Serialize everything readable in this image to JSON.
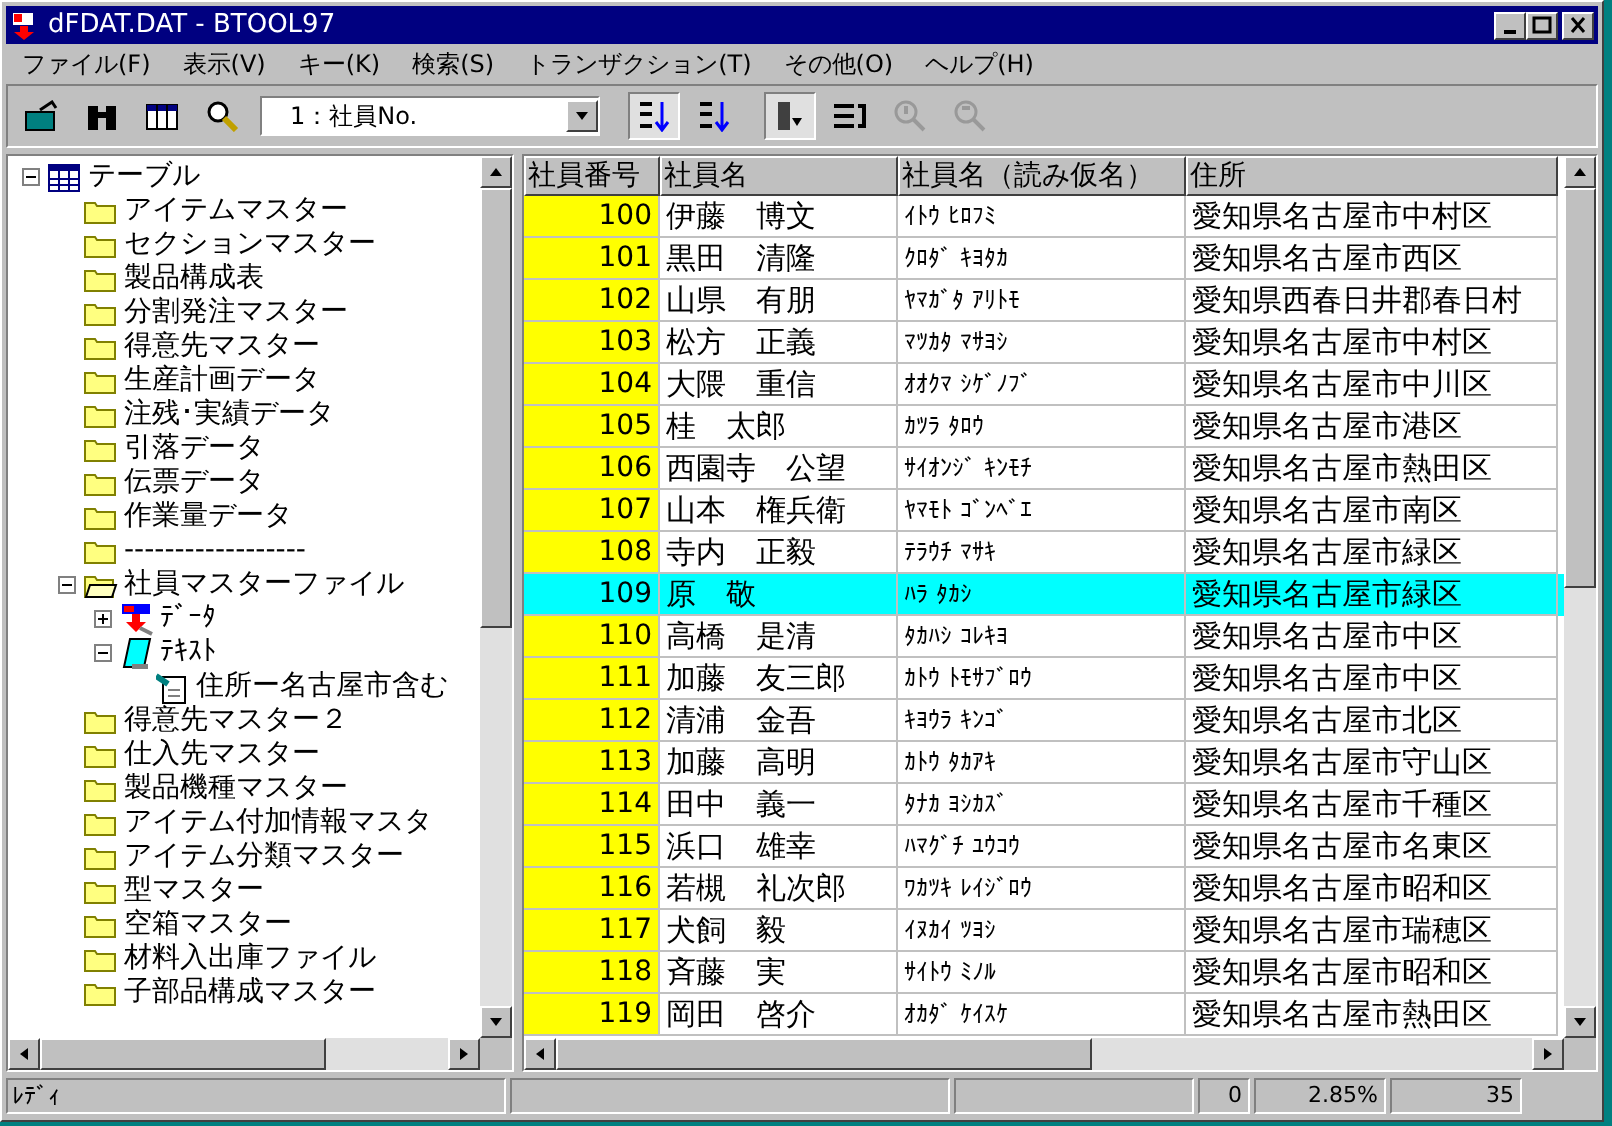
{
  "window": {
    "title": "dFDAT.DAT - BTOOL97"
  },
  "menu": [
    "ファイル(F)",
    "表示(V)",
    "キー(K)",
    "検索(S)",
    "トランザクション(T)",
    "その他(O)",
    "ヘルプ(H)"
  ],
  "toolbar": [
    {
      "kind": "open",
      "pressed": false,
      "disabled": false
    },
    {
      "kind": "find",
      "pressed": false,
      "disabled": false
    },
    {
      "kind": "columns",
      "pressed": false,
      "disabled": false
    },
    {
      "kind": "search",
      "pressed": false,
      "disabled": false
    },
    {
      "kind": "combo",
      "value": "1：社員No."
    },
    {
      "kind": "sort-asc",
      "pressed": true,
      "disabled": false
    },
    {
      "kind": "sort-desc",
      "pressed": false,
      "disabled": false
    },
    {
      "kind": "filter",
      "pressed": true,
      "disabled": false
    },
    {
      "kind": "list",
      "pressed": false,
      "disabled": false
    },
    {
      "kind": "zoom-in",
      "pressed": false,
      "disabled": true
    },
    {
      "kind": "zoom-out",
      "pressed": false,
      "disabled": true
    }
  ],
  "tree": [
    {
      "kind": "table",
      "label": "テーブル",
      "expanded": true,
      "children": [
        {
          "kind": "folder",
          "label": "アイテムマスター"
        },
        {
          "kind": "folder",
          "label": "セクションマスター"
        },
        {
          "kind": "folder",
          "label": "製品構成表"
        },
        {
          "kind": "folder",
          "label": "分割発注マスター"
        },
        {
          "kind": "folder",
          "label": "得意先マスター"
        },
        {
          "kind": "folder",
          "label": "生産計画データ"
        },
        {
          "kind": "folder",
          "label": "注残･実績データ"
        },
        {
          "kind": "folder",
          "label": "引落データ"
        },
        {
          "kind": "folder",
          "label": "伝票データ"
        },
        {
          "kind": "folder",
          "label": "作業量データ"
        },
        {
          "kind": "folder",
          "label": "------------------"
        },
        {
          "kind": "folder-open",
          "label": "社員マスターファイル",
          "expanded": true,
          "children": [
            {
              "kind": "data",
              "label": "ﾃﾞｰﾀ",
              "expanded": false
            },
            {
              "kind": "text",
              "label": "ﾃｷｽﾄ",
              "expanded": true,
              "children": [
                {
                  "kind": "file",
                  "label": "住所ー名古屋市含む"
                }
              ]
            }
          ]
        },
        {
          "kind": "folder",
          "label": "得意先マスター２"
        },
        {
          "kind": "folder",
          "label": "仕入先マスター"
        },
        {
          "kind": "folder",
          "label": "製品機種マスター"
        },
        {
          "kind": "folder",
          "label": "アイテム付加情報マスタ"
        },
        {
          "kind": "folder",
          "label": "アイテム分類マスター"
        },
        {
          "kind": "folder",
          "label": "型マスター"
        },
        {
          "kind": "folder",
          "label": "空箱マスター"
        },
        {
          "kind": "folder",
          "label": "材料入出庫ファイル"
        },
        {
          "kind": "folder",
          "label": "子部品構成マスター"
        }
      ]
    }
  ],
  "table": {
    "columns": [
      "社員番号",
      "社員名",
      "社員名（読み仮名）",
      "住所"
    ],
    "rows": [
      {
        "cells": [
          "100",
          "伊藤　博文",
          "ｲﾄｳ ﾋﾛﾌﾐ",
          "愛知県名古屋市中村区"
        ],
        "selected": false
      },
      {
        "cells": [
          "101",
          "黒田　清隆",
          "ｸﾛﾀﾞ ｷﾖﾀｶ",
          "愛知県名古屋市西区"
        ],
        "selected": false
      },
      {
        "cells": [
          "102",
          "山県　有朋",
          "ﾔﾏｶﾞﾀ ｱﾘﾄﾓ",
          "愛知県西春日井郡春日村"
        ],
        "selected": false
      },
      {
        "cells": [
          "103",
          "松方　正義",
          "ﾏﾂｶﾀ ﾏｻﾖｼ",
          "愛知県名古屋市中村区"
        ],
        "selected": false
      },
      {
        "cells": [
          "104",
          "大隈　重信",
          "ｵｵｸﾏ ｼｹﾞﾉﾌﾞ",
          "愛知県名古屋市中川区"
        ],
        "selected": false
      },
      {
        "cells": [
          "105",
          "桂　太郎",
          "ｶﾂﾗ ﾀﾛｳ",
          "愛知県名古屋市港区"
        ],
        "selected": false
      },
      {
        "cells": [
          "106",
          "西園寺　公望",
          "ｻｲｵﾝｼﾞ ｷﾝﾓﾁ",
          "愛知県名古屋市熱田区"
        ],
        "selected": false
      },
      {
        "cells": [
          "107",
          "山本　権兵衛",
          "ﾔﾏﾓﾄ ｺﾞﾝﾍﾞｴ",
          "愛知県名古屋市南区"
        ],
        "selected": false
      },
      {
        "cells": [
          "108",
          "寺内　正毅",
          "ﾃﾗｳﾁ ﾏｻｷ",
          "愛知県名古屋市緑区"
        ],
        "selected": false
      },
      {
        "cells": [
          "109",
          "原　敬",
          "ﾊﾗ ﾀｶｼ",
          "愛知県名古屋市緑区"
        ],
        "selected": true
      },
      {
        "cells": [
          "110",
          "高橋　是清",
          "ﾀｶﾊｼ ｺﾚｷﾖ",
          "愛知県名古屋市中区"
        ],
        "selected": false
      },
      {
        "cells": [
          "111",
          "加藤　友三郎",
          "ｶﾄｳ ﾄﾓｻﾌﾞﾛｳ",
          "愛知県名古屋市中区"
        ],
        "selected": false
      },
      {
        "cells": [
          "112",
          "清浦　金吾",
          "ｷﾖｳﾗ ｷﾝｺﾞ",
          "愛知県名古屋市北区"
        ],
        "selected": false
      },
      {
        "cells": [
          "113",
          "加藤　高明",
          "ｶﾄｳ ﾀｶｱｷ",
          "愛知県名古屋市守山区"
        ],
        "selected": false
      },
      {
        "cells": [
          "114",
          "田中　義一",
          "ﾀﾅｶ ﾖｼｶｽﾞ",
          "愛知県名古屋市千種区"
        ],
        "selected": false
      },
      {
        "cells": [
          "115",
          "浜口　雄幸",
          "ﾊﾏｸﾞﾁ ﾕｳｺｳ",
          "愛知県名古屋市名東区"
        ],
        "selected": false
      },
      {
        "cells": [
          "116",
          "若槻　礼次郎",
          "ﾜｶﾂｷ ﾚｲｼﾞﾛｳ",
          "愛知県名古屋市昭和区"
        ],
        "selected": false
      },
      {
        "cells": [
          "117",
          "犬飼　毅",
          "ｲﾇｶｲ ﾂﾖｼ",
          "愛知県名古屋市瑞穂区"
        ],
        "selected": false
      },
      {
        "cells": [
          "118",
          "斉藤　実",
          "ｻｲﾄｳ ﾐﾉﾙ",
          "愛知県名古屋市昭和区"
        ],
        "selected": false
      },
      {
        "cells": [
          "119",
          "岡田　啓介",
          "ｵｶﾀﾞ ｹｲｽｹ",
          "愛知県名古屋市熱田区"
        ],
        "selected": false
      }
    ]
  },
  "status_bar": {
    "message": "ﾚﾃﾞｨ",
    "fields": [
      "0",
      "2.85%",
      "35"
    ]
  }
}
